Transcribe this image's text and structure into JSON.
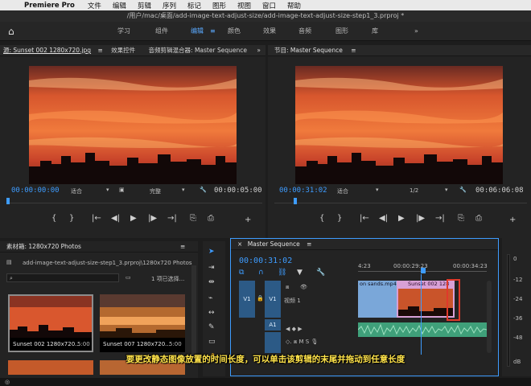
{
  "menubar": {
    "app": "Premiere Pro",
    "items": [
      "文件",
      "编辑",
      "剪辑",
      "序列",
      "标记",
      "图形",
      "视图",
      "窗口",
      "帮助"
    ]
  },
  "titlebar": {
    "path": "/用户/mac/桌面/add-image-text-adjust-size/add-image-text-adjust-size-step1_3.prproj *"
  },
  "workspaces": {
    "tabs": [
      "学习",
      "组件",
      "编辑",
      "颜色",
      "效果",
      "音频",
      "图形",
      "库"
    ],
    "active": "编辑",
    "more": "»"
  },
  "source_monitor": {
    "tab_source": "源: Sunset 002 1280x720.jpg",
    "tab_effects": "效果控件",
    "tab_mixer": "音频剪辑混合器: Master Sequence",
    "more": "»",
    "timecode": "00:00:00:00",
    "fit": "适合",
    "quality": "完整",
    "duration": "00:00:05:00"
  },
  "program_monitor": {
    "title": "节目: Master Sequence",
    "menu": "≡",
    "timecode": "00:00:31:02",
    "fit": "适合",
    "resolution": "1/2",
    "duration": "00:06:06:08"
  },
  "transport": [
    "{",
    "}",
    "|←",
    "◀|",
    "▶",
    "|▶",
    "→|",
    "⎘",
    "⎙"
  ],
  "project": {
    "title": "素材箱: 1280x720 Photos",
    "menu": "≡",
    "path": "add-image-text-adjust-size-step1_3.prproj\\1280x720 Photos",
    "search_placeholder": "",
    "selection": "1 项已选择...",
    "items": [
      {
        "name": "Sunset 002 1280x720...",
        "duration": "5:00"
      },
      {
        "name": "Sunset 007 1280x720...",
        "duration": "5:00"
      }
    ]
  },
  "timeline": {
    "title": "Master Sequence",
    "menu": "≡",
    "timecode": "00:00:31:02",
    "ruler": [
      "4:23",
      "00:00:29:23",
      "00:00:34:23"
    ],
    "tracks": [
      {
        "label": "V1",
        "name": "视频 1"
      },
      {
        "label": "A1",
        "name": ""
      }
    ],
    "clips": {
      "v_left": "on sands.mp4",
      "v_right": "Sunset 002 128"
    },
    "audio_levels": [
      "0",
      "-12",
      "-24",
      "-36",
      "-48",
      "dB"
    ]
  },
  "caption": "要更改静态图像放置的时间长度，可以单击该剪辑的末尾并拖动到任意长度",
  "colors": {
    "accent": "#3e9cff",
    "caption": "#ffe34a",
    "highlight": "#e0392b"
  }
}
